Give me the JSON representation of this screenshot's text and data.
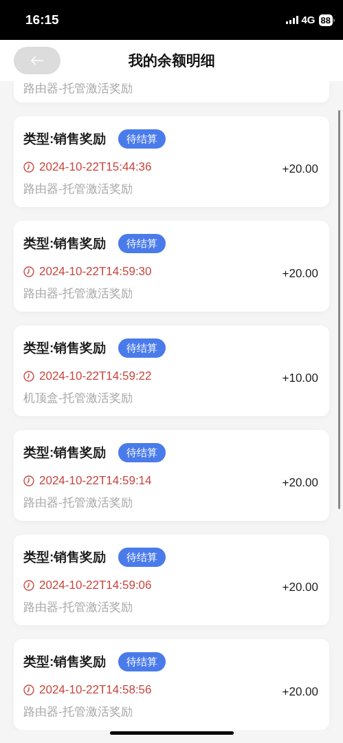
{
  "status_bar": {
    "time": "16:15",
    "network": "4G",
    "battery": "88"
  },
  "header": {
    "title": "我的余额明细"
  },
  "records": [
    {
      "kind": "partial",
      "description": "路由器-托管激活奖励"
    },
    {
      "kind": "full",
      "type": "类型:销售奖励",
      "badge": "待结算",
      "time": "2024-10-22T15:44:36",
      "amount": "+20.00",
      "description": "路由器-托管激活奖励"
    },
    {
      "kind": "full",
      "type": "类型:销售奖励",
      "badge": "待结算",
      "time": "2024-10-22T14:59:30",
      "amount": "+20.00",
      "description": "路由器-托管激活奖励"
    },
    {
      "kind": "full",
      "type": "类型:销售奖励",
      "badge": "待结算",
      "time": "2024-10-22T14:59:22",
      "amount": "+10.00",
      "description": "机顶盒-托管激活奖励"
    },
    {
      "kind": "full",
      "type": "类型:销售奖励",
      "badge": "待结算",
      "time": "2024-10-22T14:59:14",
      "amount": "+20.00",
      "description": "路由器-托管激活奖励"
    },
    {
      "kind": "full",
      "type": "类型:销售奖励",
      "badge": "待结算",
      "time": "2024-10-22T14:59:06",
      "amount": "+20.00",
      "description": "路由器-托管激活奖励"
    },
    {
      "kind": "full",
      "type": "类型:销售奖励",
      "badge": "待结算",
      "time": "2024-10-22T14:58:56",
      "amount": "+20.00",
      "description": "路由器-托管激活奖励"
    }
  ]
}
